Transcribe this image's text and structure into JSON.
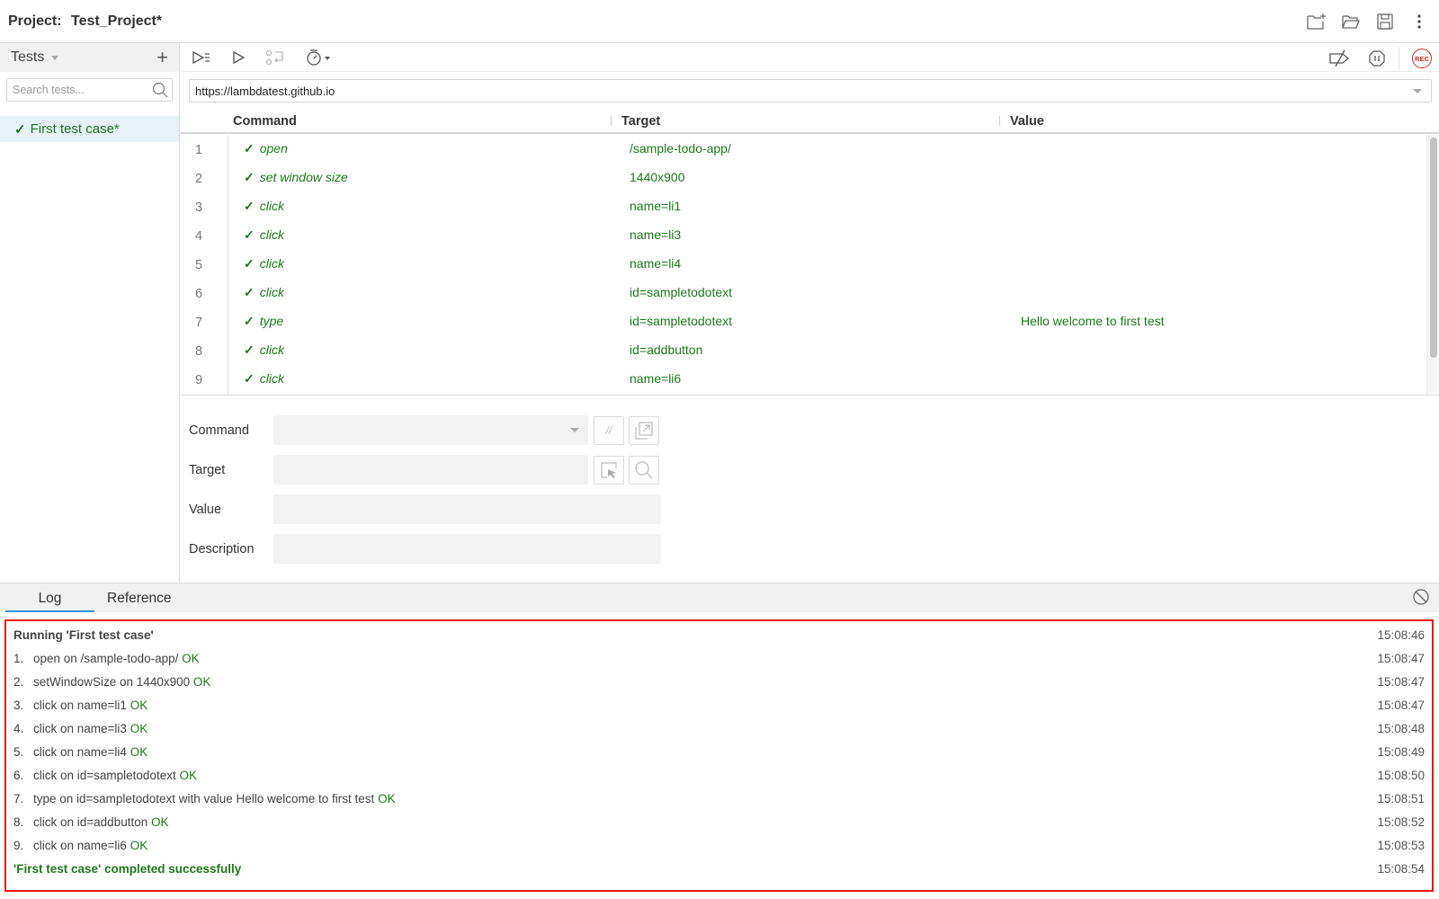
{
  "header": {
    "project_label": "Project:",
    "project_name": "Test_Project*",
    "actions": [
      {
        "name": "new-project-icon"
      },
      {
        "name": "open-project-icon"
      },
      {
        "name": "save-project-icon"
      },
      {
        "name": "more-options-icon"
      }
    ]
  },
  "sidebar": {
    "title": "Tests",
    "add_label": "+",
    "search_placeholder": "Search tests...",
    "tests": [
      {
        "check": "✓",
        "label": "First test case*",
        "selected": true
      }
    ]
  },
  "toolbar": {
    "left": [
      "run-all-tests-icon",
      "run-current-test-icon",
      "step-over-icon",
      "speed-timer-icon"
    ],
    "right": [
      "disable-breakpoints-icon",
      "pause-on-exceptions-icon",
      "record-icon"
    ],
    "rec_label": "REC"
  },
  "url": {
    "value": "https://lambdatest.github.io"
  },
  "table": {
    "headers": {
      "command": "Command",
      "target": "Target",
      "value": "Value"
    },
    "check": "✓",
    "rows": [
      {
        "num": "1",
        "command": "open",
        "target": "/sample-todo-app/",
        "value": ""
      },
      {
        "num": "2",
        "command": "set window size",
        "target": "1440x900",
        "value": ""
      },
      {
        "num": "3",
        "command": "click",
        "target": "name=li1",
        "value": ""
      },
      {
        "num": "4",
        "command": "click",
        "target": "name=li3",
        "value": ""
      },
      {
        "num": "5",
        "command": "click",
        "target": "name=li4",
        "value": ""
      },
      {
        "num": "6",
        "command": "click",
        "target": "id=sampletodotext",
        "value": ""
      },
      {
        "num": "7",
        "command": "type",
        "target": "id=sampletodotext",
        "value": "Hello welcome to first test"
      },
      {
        "num": "8",
        "command": "click",
        "target": "id=addbutton",
        "value": ""
      },
      {
        "num": "9",
        "command": "click",
        "target": "name=li6",
        "value": ""
      }
    ]
  },
  "form": {
    "command_label": "Command",
    "target_label": "Target",
    "value_label": "Value",
    "description_label": "Description",
    "command_value": "",
    "target_value": "",
    "value_value": "",
    "description_value": "",
    "comment_btn": "//"
  },
  "bottom": {
    "tabs": {
      "log": "Log",
      "reference": "Reference"
    },
    "active_tab": "Log",
    "log": {
      "header": {
        "text": "Running 'First test case'",
        "time": "15:08:46"
      },
      "entries": [
        {
          "num": "1.",
          "text": "open on /sample-todo-app/",
          "status": "OK",
          "time": "15:08:47"
        },
        {
          "num": "2.",
          "text": "setWindowSize on 1440x900",
          "status": "OK",
          "time": "15:08:47"
        },
        {
          "num": "3.",
          "text": "click on name=li1",
          "status": "OK",
          "time": "15:08:47"
        },
        {
          "num": "4.",
          "text": "click on name=li3",
          "status": "OK",
          "time": "15:08:48"
        },
        {
          "num": "5.",
          "text": "click on name=li4",
          "status": "OK",
          "time": "15:08:49"
        },
        {
          "num": "6.",
          "text": "click on id=sampletodotext",
          "status": "OK",
          "time": "15:08:50"
        },
        {
          "num": "7.",
          "text": "type on id=sampletodotext with value Hello welcome to first test",
          "status": "OK",
          "time": "15:08:51"
        },
        {
          "num": "8.",
          "text": "click on id=addbutton",
          "status": "OK",
          "time": "15:08:52"
        },
        {
          "num": "9.",
          "text": "click on name=li6",
          "status": "OK",
          "time": "15:08:53"
        }
      ],
      "footer": {
        "text": "'First test case' completed successfully",
        "time": "15:08:54"
      }
    }
  },
  "colors": {
    "success": "#1d7a1d",
    "record": "#d52b2b",
    "highlight_border": "#e81818",
    "tab_active": "#3a8fd6"
  }
}
